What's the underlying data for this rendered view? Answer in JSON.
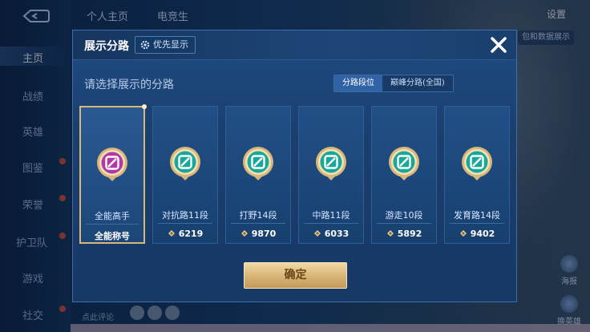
{
  "topbar": {
    "tab_profile": "个人主页",
    "tab_esports": "电竞生",
    "settings": "设置",
    "right_button": "包和数据展示"
  },
  "sidebar": {
    "items": [
      {
        "label": "主页",
        "active": true
      },
      {
        "label": "战绩"
      },
      {
        "label": "英雄"
      },
      {
        "label": "图鉴",
        "dot": true
      },
      {
        "label": "荣誉",
        "dot": true
      },
      {
        "label": "护卫队",
        "dot": true
      },
      {
        "label": "游戏"
      },
      {
        "label": "社交",
        "dot": true
      }
    ]
  },
  "right_icons": {
    "poster": "海报",
    "swap_hero": "换英雄"
  },
  "bottom": {
    "chat_hint": "点此评论"
  },
  "dialog": {
    "title": "展示分路",
    "priority_button": "优先显示",
    "prompt": "请选择展示的分路",
    "segments": [
      {
        "label": "分路段位",
        "active": true
      },
      {
        "label": "巅峰分路(全国)",
        "active": false
      }
    ],
    "cards": [
      {
        "name": "全能高手",
        "value": "全能称号",
        "icon": "all-round-emblem-icon",
        "color": "#b23aa8",
        "selected": true
      },
      {
        "name": "对抗路11段",
        "value": "6219",
        "icon": "clash-lane-emblem-icon",
        "color": "#1aa79a"
      },
      {
        "name": "打野14段",
        "value": "9870",
        "icon": "jungle-emblem-icon",
        "color": "#1aa79a"
      },
      {
        "name": "中路11段",
        "value": "6033",
        "icon": "mid-lane-emblem-icon",
        "color": "#1aa79a"
      },
      {
        "name": "游走10段",
        "value": "5892",
        "icon": "roam-emblem-icon",
        "color": "#1aa79a"
      },
      {
        "name": "发育路14段",
        "value": "9402",
        "icon": "farm-lane-emblem-icon",
        "color": "#1aa79a"
      }
    ],
    "confirm_label": "确定"
  },
  "colors": {
    "accent_gold": "#d9b77a",
    "panel_blue": "#1f4c83",
    "emblem_teal": "#1aa79a",
    "emblem_purple": "#b23aa8"
  }
}
